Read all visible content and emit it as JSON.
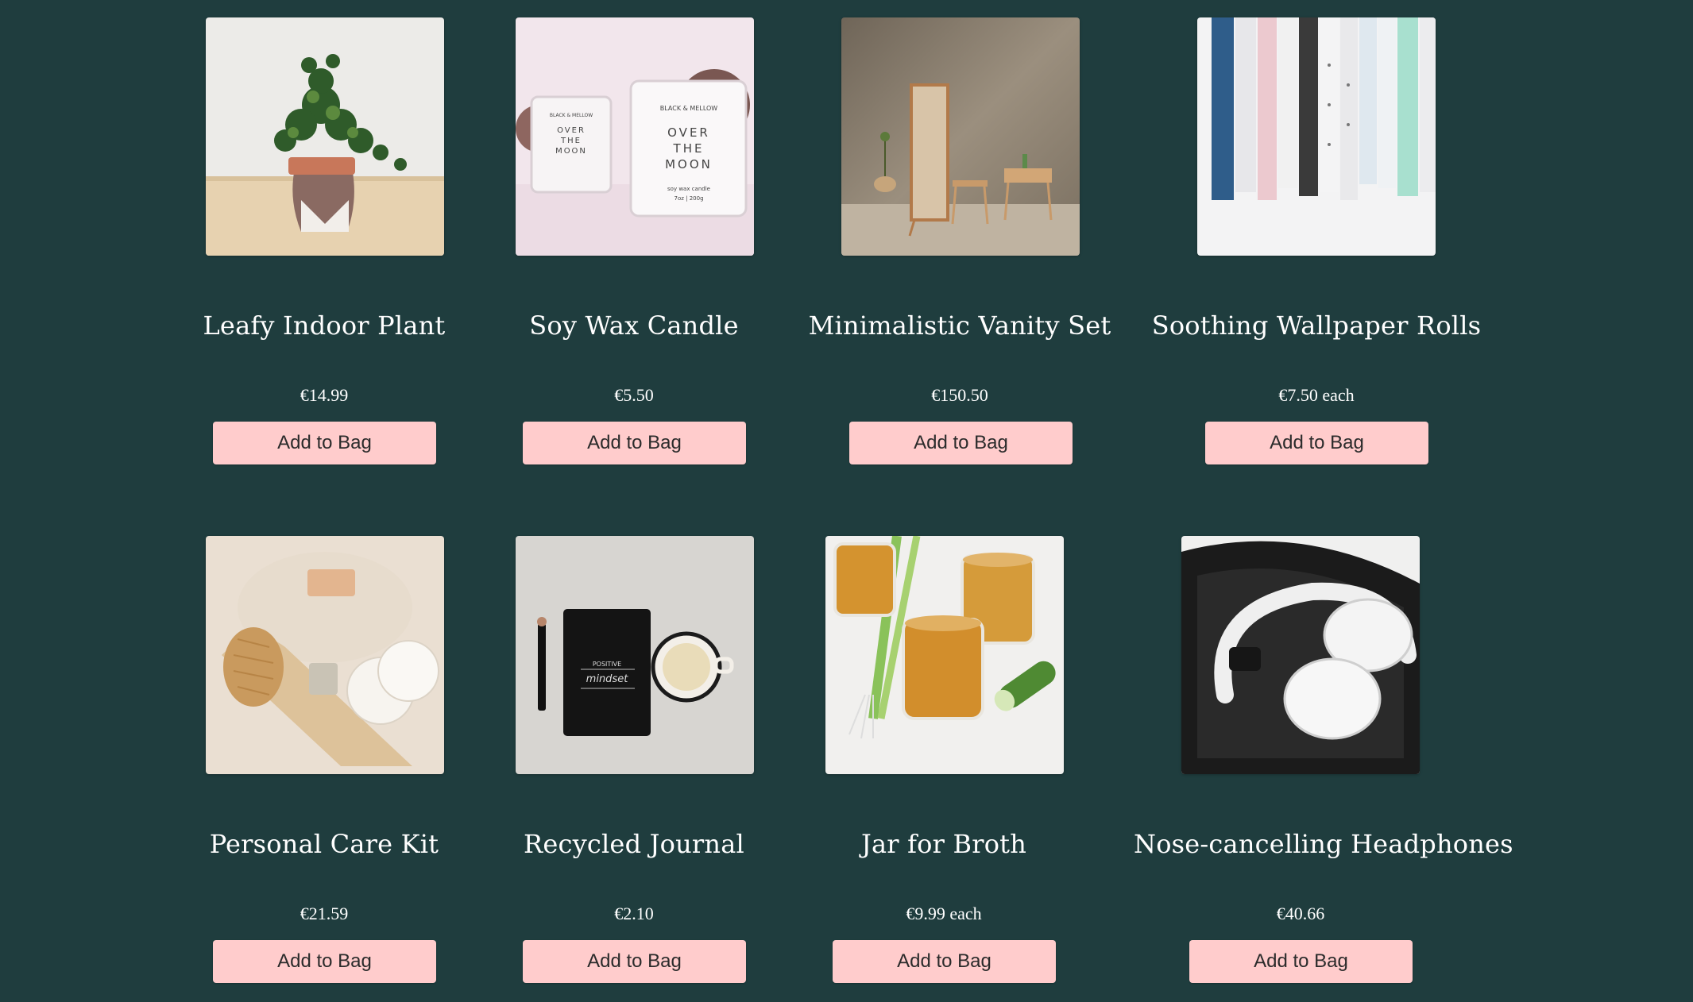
{
  "theme": {
    "background": "#1f3d3e",
    "button_bg": "#ffcccc",
    "title_color": "#ffffff"
  },
  "products": [
    {
      "name": "Leafy Indoor Plant",
      "price": "€14.99",
      "button": "Add to Bag",
      "image": "plant-photo"
    },
    {
      "name": "Soy Wax Candle",
      "price": "€5.50",
      "button": "Add to Bag",
      "image": "candle-photo"
    },
    {
      "name": "Minimalistic Vanity Set",
      "price": "€150.50",
      "button": "Add to Bag",
      "image": "vanity-photo"
    },
    {
      "name": "Soothing Wallpaper Rolls",
      "price": "€7.50 each",
      "button": "Add to Bag",
      "image": "wallpaper-photo"
    },
    {
      "name": "Personal Care Kit",
      "price": "€21.59",
      "button": "Add to Bag",
      "image": "care-kit-photo"
    },
    {
      "name": "Recycled Journal",
      "price": "€2.10",
      "button": "Add to Bag",
      "image": "journal-photo"
    },
    {
      "name": "Jar for Broth",
      "price": "€9.99 each",
      "button": "Add to Bag",
      "image": "broth-jar-photo"
    },
    {
      "name": "Nose-cancelling Headphones",
      "price": "€40.66",
      "button": "Add to Bag",
      "image": "headphones-photo"
    }
  ],
  "candle_label": {
    "brand": "BLACK & MELLOW",
    "line1": "OVER",
    "line2": "THE",
    "line3": "MOON",
    "sub1": "soy wax candle",
    "sub2": "7oz | 200g"
  },
  "journal_label": {
    "line1": "POSITIVE",
    "line2": "mindset"
  }
}
